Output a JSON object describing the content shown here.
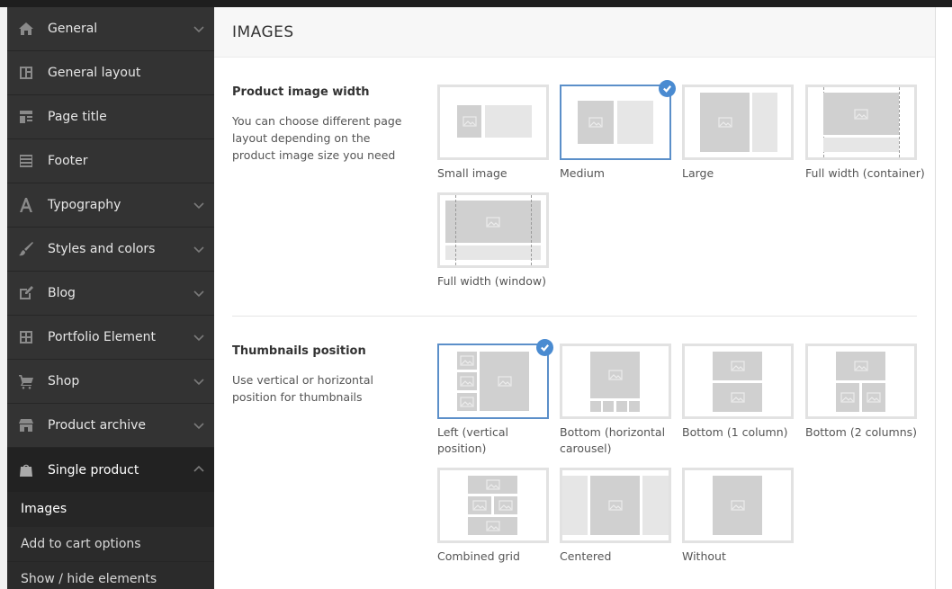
{
  "sidebar": {
    "items": [
      {
        "label": "General",
        "icon": "home-icon",
        "chevron": "down"
      },
      {
        "label": "General layout",
        "icon": "layout-icon",
        "chevron": ""
      },
      {
        "label": "Page title",
        "icon": "page-title-icon",
        "chevron": ""
      },
      {
        "label": "Footer",
        "icon": "footer-icon",
        "chevron": ""
      },
      {
        "label": "Typography",
        "icon": "typography-icon",
        "chevron": "down"
      },
      {
        "label": "Styles and colors",
        "icon": "brush-icon",
        "chevron": "down"
      },
      {
        "label": "Blog",
        "icon": "blog-icon",
        "chevron": "down"
      },
      {
        "label": "Portfolio Element",
        "icon": "grid-icon",
        "chevron": "down"
      },
      {
        "label": "Shop",
        "icon": "cart-icon",
        "chevron": "down"
      },
      {
        "label": "Product archive",
        "icon": "store-icon",
        "chevron": "down"
      },
      {
        "label": "Single product",
        "icon": "bag-icon",
        "chevron": "up"
      }
    ],
    "subitems": [
      {
        "label": "Images"
      },
      {
        "label": "Add to cart options"
      },
      {
        "label": "Show / hide elements"
      }
    ]
  },
  "main": {
    "title": "IMAGES",
    "product_width": {
      "title": "Product image width",
      "description": "You can choose different page layout depending on the product image size you need",
      "options": [
        {
          "label": "Small image"
        },
        {
          "label": "Medium",
          "selected": true
        },
        {
          "label": "Large"
        },
        {
          "label": "Full width (container)"
        },
        {
          "label": "Full width (window)"
        }
      ]
    },
    "thumbnails": {
      "title": "Thumbnails position",
      "description": "Use vertical or horizontal position for thumbnails",
      "options": [
        {
          "label": "Left (vertical position)",
          "selected": true
        },
        {
          "label": "Bottom (horizontal carousel)"
        },
        {
          "label": "Bottom (1 column)"
        },
        {
          "label": "Bottom (2 columns)"
        },
        {
          "label": "Combined grid"
        },
        {
          "label": "Centered"
        },
        {
          "label": "Without"
        }
      ]
    }
  },
  "colors": {
    "accent": "#4a8bd1",
    "sidebar_bg": "#333333",
    "placeholder": "#d0d0d0"
  }
}
